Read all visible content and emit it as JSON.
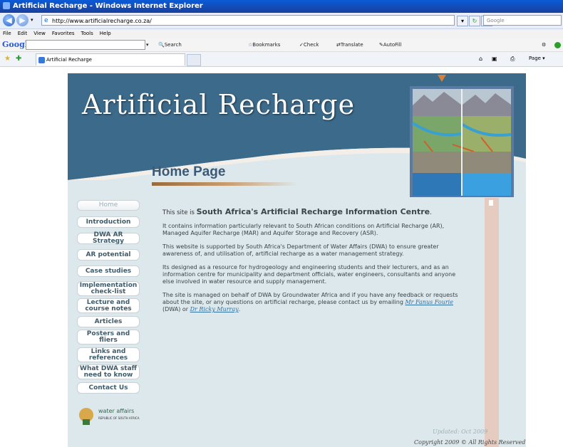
{
  "window": {
    "title": "Artificial Recharge - Windows Internet Explorer"
  },
  "address_bar": {
    "url": "http://www.artificialrecharge.co.za/",
    "search_placeholder": "Google"
  },
  "menu": [
    "File",
    "Edit",
    "View",
    "Favorites",
    "Tools",
    "Help"
  ],
  "google_toolbar": {
    "logo": "Google",
    "items": [
      "Search",
      "Bookmarks",
      "Check",
      "Translate",
      "AutoFill"
    ]
  },
  "tab": {
    "label": "Artificial Recharge"
  },
  "command_bar": {
    "page_label": "Page"
  },
  "site": {
    "title": "Artificial Recharge",
    "page_heading": "Home Page",
    "nav": [
      "Home",
      "Introduction",
      "DWA AR Strategy",
      "AR potential",
      "Case studies",
      "Implementation check-list",
      "Lecture and course notes",
      "Articles",
      "Posters and fliers",
      "Links and references",
      "What DWA staff need to know",
      "Contact Us"
    ],
    "intro_prefix": "This site is ",
    "intro_big": "South Africa's Artificial Recharge Information Centre",
    "intro_suffix": ".",
    "paragraphs": [
      "It contains information particularly relevant to South African conditions on Artificial Recharge (AR), Managed Aquifer Recharge (MAR) and Aquifer Storage and Recovery (ASR).",
      "This website is supported by South Africa's Department of Water Affairs (DWA) to ensure greater awareness of, and utilisation of, artificial recharge as a water management strategy.",
      "Its designed as a resource for hydrogeology and engineering students and their lecturers, and as an information centre for municipality and department officials, water engineers, consultants and anyone else involved in water resource and supply management."
    ],
    "contact_text": "The site is managed on behalf of DWA by Groundwater Africa and if you have any feedback or requests about the site, or any questions on artificial recharge, please contact us by emailing ",
    "contact1_name": "Mr Fanus Fourie",
    "contact1_org": " (DWA) or ",
    "contact2_name": "Dr Ricky Murray",
    "contact_end": ".",
    "updated": "Updated: Oct 2009",
    "copyright": "Copyright 2009 © All Rights Reserved",
    "logo_line1": "water affairs",
    "logo_line2": "REPUBLIC OF SOUTH AFRICA"
  },
  "colors": {
    "header_blue": "#3a6a8a",
    "content_bg": "#dde8ec",
    "accent_orange": "#d5803a"
  }
}
